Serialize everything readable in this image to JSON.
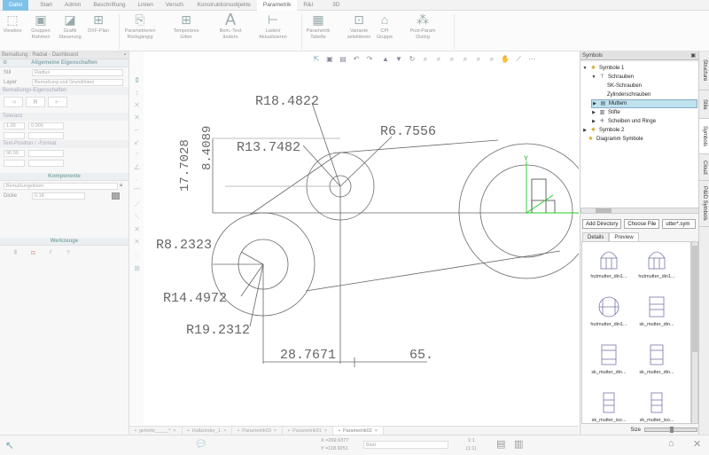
{
  "menu": {
    "tabs": [
      "Datei",
      "Start",
      "Admin",
      "Beschriftung",
      "Linien",
      "Versch.",
      "Konstruktionsobjekte",
      "Parametrik",
      "R&I",
      "3D"
    ]
  },
  "ribbon": {
    "buttons": [
      {
        "label": "Viewbox",
        "icon": "viewbox-icon"
      },
      {
        "label": "Gruppen Rahmen",
        "icon": "group-frame-icon"
      },
      {
        "label": "Grafik Steuerung",
        "icon": "graphic-control-icon"
      },
      {
        "label": "DXF-Plan",
        "icon": "dxf-plan-icon"
      },
      {
        "label": "Parametrieren Rückgängig",
        "icon": "undo-param-icon"
      },
      {
        "label": "Temporäres Gitter",
        "icon": "temp-grid-icon"
      },
      {
        "label": "Bem.-Text ändern",
        "icon": "text-edit-icon"
      },
      {
        "label": "Laden/ Aktualisieren",
        "icon": "load-refresh-icon"
      },
      {
        "label": "Parametrik Tabelle",
        "icon": "param-table-icon"
      },
      {
        "label": "Variante selektieren",
        "icon": "variant-select-icon"
      },
      {
        "label": "CPI Gruppe",
        "icon": "cpi-group-icon"
      },
      {
        "label": "Post-Param Dialog",
        "icon": "post-param-icon"
      }
    ]
  },
  "left_panel": {
    "title": "Bemaßung : Radial - Dashboard",
    "sections": {
      "general": "Allgemeine Eigenschaften",
      "dimension": "Bemaßungs-Eigenschaften",
      "tolerance": "Toleranz",
      "text_position": "Text-Position / -Format",
      "components": "Komponente",
      "tools": "Werkzeuge"
    },
    "style_label": "Stil",
    "style_value": "Radius",
    "layer_label": "Layer",
    "layer_value": "Bemaßung und Grundlinien",
    "tolerance_value": "1.00",
    "tolerance_value2": "0.000",
    "text_angle": "90.00",
    "component_value": "Bemaßungslinien",
    "thickness_label": "Dicke",
    "thickness_value": "0.18"
  },
  "drawing": {
    "dims": {
      "r1": "R18.4822",
      "r2": "R13.7482",
      "r3": "R6.7556",
      "r4": "R8.2323",
      "r5": "R14.4972",
      "r6": "R19.2312",
      "d1": "28.7671",
      "d2": "65.",
      "v1": "17.7028",
      "v2": "8.4089"
    },
    "axis_y": "Y"
  },
  "doc_tabs": [
    "gehelte_____*",
    "Halbzinder_1",
    "Parametrik03",
    "Parametrik01",
    "Parametrik02"
  ],
  "right_panel": {
    "title": "Symbols",
    "tree": [
      {
        "label": "Symbole 1",
        "level": 0,
        "twisty": "▼"
      },
      {
        "label": "Schrauben",
        "level": 1,
        "twisty": "▼"
      },
      {
        "label": "SK-Schrauben",
        "level": 2,
        "twisty": ""
      },
      {
        "label": "Zylinderschrauben",
        "level": 2,
        "twisty": ""
      },
      {
        "label": "Muttern",
        "level": 1,
        "twisty": "▶",
        "selected": true
      },
      {
        "label": "Stifte",
        "level": 1,
        "twisty": "▶"
      },
      {
        "label": "Scheiben und Ringe",
        "level": 1,
        "twisty": "▶"
      },
      {
        "label": "Symbole 2",
        "level": 0,
        "twisty": "▶"
      },
      {
        "label": "Diagramm Symbole",
        "level": 0,
        "twisty": ""
      }
    ],
    "add_directory": "Add Directory",
    "choose_file": "Choose File",
    "file_select": "utter*.sym",
    "tabs": [
      "Details",
      "Preview"
    ],
    "previews": [
      "hutmutter_din1...",
      "hutmutter_din1...",
      "hutmutter_din1...",
      "sk_mutter_din...",
      "sk_mutter_din...",
      "sk_mutter_din...",
      "sk_mutter_iso...",
      "sk_mutter_iso..."
    ],
    "size_label": "Size"
  },
  "side_tabs": [
    "Structure",
    "Stile",
    "Symbols",
    "Cloud",
    "P&ID Symbols"
  ],
  "status": {
    "x_coord": "X =269.6377",
    "y_coord": "Y =118.9251",
    "field": "Blatt",
    "scale": "1:1",
    "scale2": "(1:1)"
  },
  "colors": {
    "accent": "#7fc2e8",
    "selection": "#bfe2ee",
    "axis_green": "#22cc22"
  }
}
